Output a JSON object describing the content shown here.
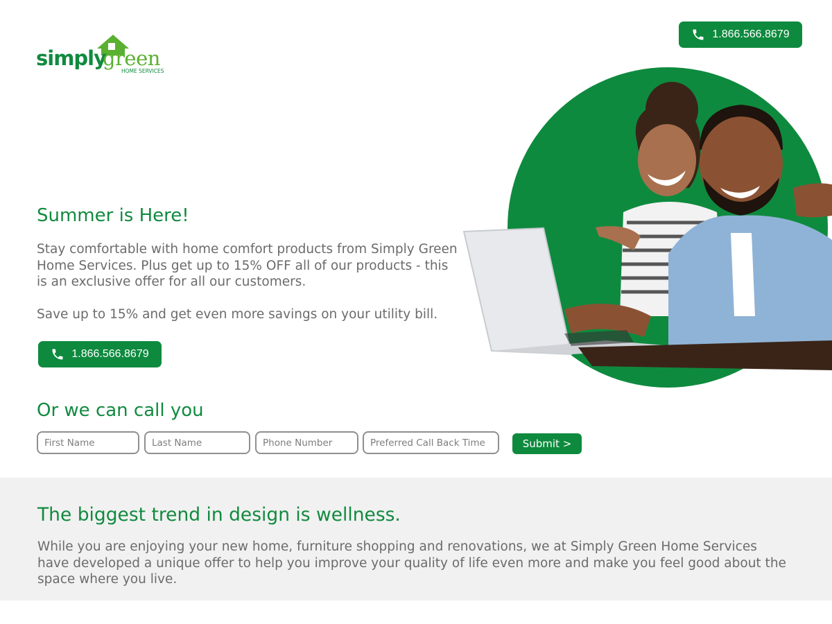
{
  "brand": {
    "name_part1": "simply",
    "name_part2": "green",
    "tagline": "HOME SERVICES",
    "color": "#118a3f",
    "accent": "#5ab031"
  },
  "header": {
    "phone_icon": "phone-icon",
    "phone_label": "1.866.566.8679"
  },
  "hero": {
    "title": "Summer is Here!",
    "paragraph1": "Stay comfortable with home comfort products from Simply Green Home Services. Plus get up to 15% OFF all of our products - this is an exclusive offer for all our customers.",
    "paragraph2": "Save up to 15% and get even more savings on your utility bill.",
    "phone_label": "1.866.566.8679",
    "image_description": "couple-laughing-at-laptop-photo"
  },
  "callback": {
    "title": "Or we can call you",
    "fields": {
      "first_name": "First Name",
      "last_name": "Last Name",
      "phone": "Phone Number",
      "time": "Preferred Call Back Time"
    },
    "submit_label": "Submit >"
  },
  "wellness": {
    "title": "The biggest trend in design is wellness.",
    "text": "While you are enjoying your new home, furniture shopping and renovations, we at Simply Green Home Services have developed a unique offer to help you improve your quality of life even more and make you feel good about the space where you live."
  },
  "colors": {
    "button": "#0e8a3e",
    "heading": "#118a3f",
    "band": "#f1f1f1",
    "body_text": "#6b6b6b"
  }
}
